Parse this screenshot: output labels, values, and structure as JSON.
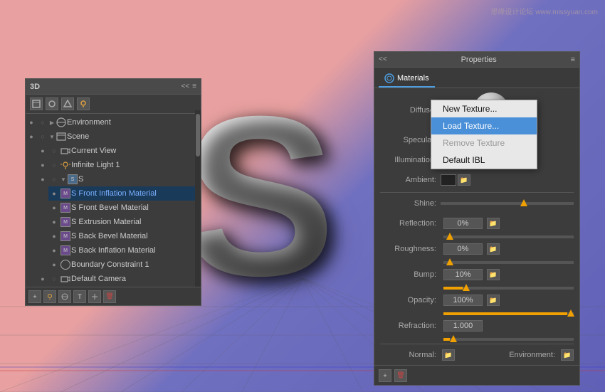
{
  "background": {
    "colors": [
      "#e8a0a0",
      "#8080c8",
      "#6060b8"
    ]
  },
  "watermark": {
    "text": "思缘设计论坛 www.missyuan.com"
  },
  "panel_3d": {
    "title": "3D",
    "collapse_label": "<<",
    "close_label": "×",
    "menu_label": "≡",
    "tree_items": [
      {
        "indent": 0,
        "label": "Environment",
        "type": "group",
        "visible": true
      },
      {
        "indent": 0,
        "label": "Scene",
        "type": "scene",
        "visible": true
      },
      {
        "indent": 1,
        "label": "Current View",
        "type": "camera",
        "visible": true
      },
      {
        "indent": 1,
        "label": "Infinite Light 1",
        "type": "light",
        "visible": true
      },
      {
        "indent": 1,
        "label": "S",
        "type": "mesh",
        "visible": true
      },
      {
        "indent": 2,
        "label": "S Front Inflation Material",
        "type": "material",
        "visible": true,
        "highlighted": true
      },
      {
        "indent": 2,
        "label": "S Front Bevel Material",
        "type": "material",
        "visible": true
      },
      {
        "indent": 2,
        "label": "S Extrusion Material",
        "type": "material",
        "visible": true
      },
      {
        "indent": 2,
        "label": "S Back Bevel Material",
        "type": "material",
        "visible": true
      },
      {
        "indent": 2,
        "label": "S Back Inflation Material",
        "type": "material",
        "visible": true
      },
      {
        "indent": 2,
        "label": "Boundary Constraint 1",
        "type": "constraint",
        "visible": true
      },
      {
        "indent": 1,
        "label": "Default Camera",
        "type": "camera",
        "visible": true
      }
    ],
    "footer_buttons": [
      "add-layer",
      "light",
      "environment",
      "text",
      "transform",
      "delete"
    ]
  },
  "panel_properties": {
    "title": "Properties",
    "collapse_label": "<<",
    "menu_label": "≡",
    "tabs": [
      {
        "label": "Materials",
        "active": true
      }
    ],
    "sections": {
      "diffuse_label": "Diffuse:",
      "specular_label": "Specular:",
      "illumination_label": "Illumination:",
      "ambient_label": "Ambient:",
      "shine_label": "Shine:",
      "reflection_label": "Reflection:",
      "reflection_value": "0%",
      "roughness_label": "Roughness:",
      "roughness_value": "0%",
      "bump_label": "Bump:",
      "bump_value": "10%",
      "opacity_label": "Opacity:",
      "opacity_value": "100%",
      "refraction_label": "Refraction:",
      "refraction_value": "1.000",
      "normal_label": "Normal:",
      "environment_label": "Environment:"
    }
  },
  "context_menu": {
    "items": [
      {
        "label": "New Texture...",
        "disabled": false
      },
      {
        "label": "Load Texture...",
        "active": true
      },
      {
        "label": "Remove Texture",
        "disabled": true
      },
      {
        "label": "Default IBL",
        "disabled": false
      }
    ]
  },
  "letter": {
    "char": "S"
  }
}
